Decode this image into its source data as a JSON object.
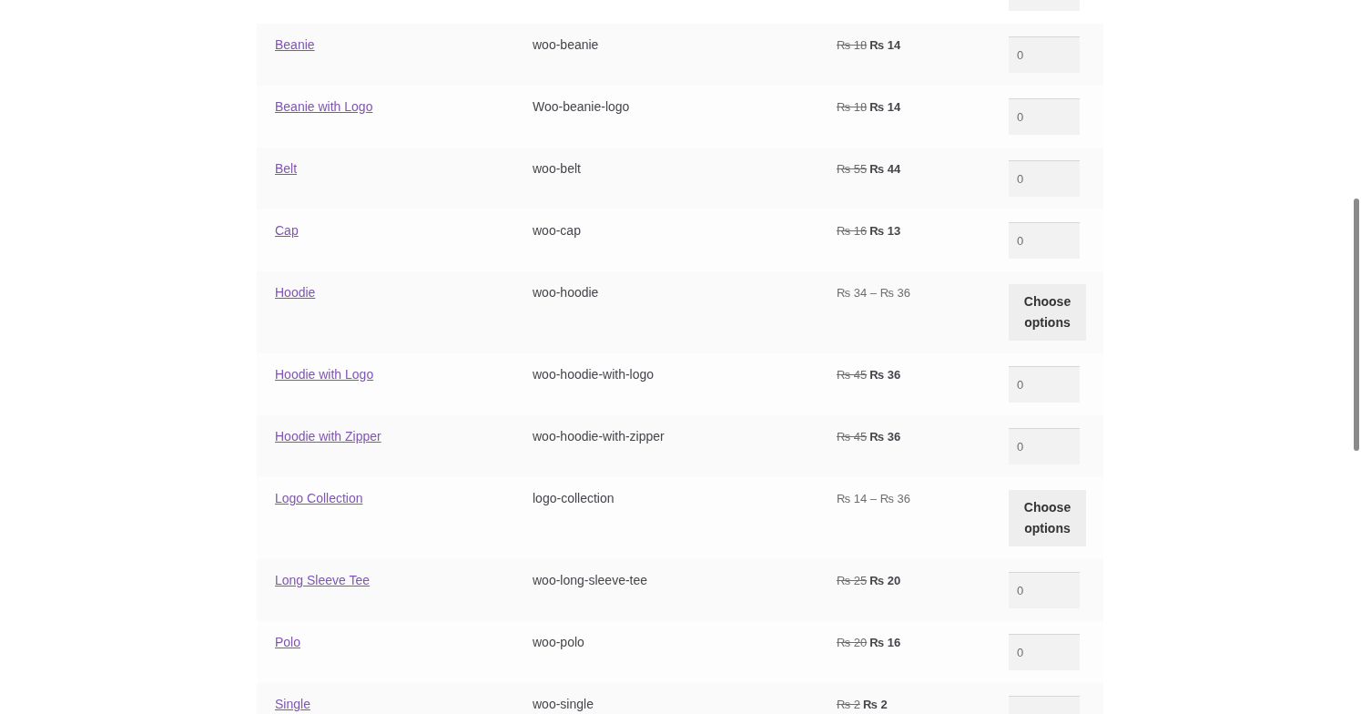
{
  "products": [
    {
      "name": "Beanie",
      "sku": "woo-beanie",
      "price": {
        "kind": "sale",
        "old": "₨ 18",
        "new": "₨ 14"
      },
      "action": {
        "kind": "quantity",
        "value": "0"
      }
    },
    {
      "name": "Beanie with Logo",
      "sku": "Woo-beanie-logo",
      "price": {
        "kind": "sale",
        "old": "₨ 18",
        "new": "₨ 14"
      },
      "action": {
        "kind": "quantity",
        "value": "0"
      }
    },
    {
      "name": "Belt",
      "sku": "woo-belt",
      "price": {
        "kind": "sale",
        "old": "₨ 55",
        "new": "₨ 44"
      },
      "action": {
        "kind": "quantity",
        "value": "0"
      }
    },
    {
      "name": "Cap",
      "sku": "woo-cap",
      "price": {
        "kind": "sale",
        "old": "₨ 16",
        "new": "₨ 13"
      },
      "action": {
        "kind": "quantity",
        "value": "0"
      }
    },
    {
      "name": "Hoodie",
      "sku": "woo-hoodie",
      "price": {
        "kind": "range",
        "text": "₨ 34 – ₨ 36"
      },
      "action": {
        "kind": "options",
        "label": "Choose options"
      }
    },
    {
      "name": "Hoodie with Logo",
      "sku": "woo-hoodie-with-logo",
      "price": {
        "kind": "sale",
        "old": "₨ 45",
        "new": "₨ 36"
      },
      "action": {
        "kind": "quantity",
        "value": "0"
      }
    },
    {
      "name": "Hoodie with Zipper",
      "sku": "woo-hoodie-with-zipper",
      "price": {
        "kind": "sale",
        "old": "₨ 45",
        "new": "₨ 36"
      },
      "action": {
        "kind": "quantity",
        "value": "0"
      }
    },
    {
      "name": "Logo Collection",
      "sku": "logo-collection",
      "price": {
        "kind": "range",
        "text": "₨ 14 – ₨ 36"
      },
      "action": {
        "kind": "options",
        "label": "Choose options"
      }
    },
    {
      "name": "Long Sleeve Tee",
      "sku": "woo-long-sleeve-tee",
      "price": {
        "kind": "sale",
        "old": "₨ 25",
        "new": "₨ 20"
      },
      "action": {
        "kind": "quantity",
        "value": "0"
      }
    },
    {
      "name": "Polo",
      "sku": "woo-polo",
      "price": {
        "kind": "sale",
        "old": "₨ 20",
        "new": "₨ 16"
      },
      "action": {
        "kind": "quantity",
        "value": "0"
      }
    },
    {
      "name": "Single",
      "sku": "woo-single",
      "price": {
        "kind": "sale",
        "old": "₨ 2",
        "new": "₨ 2"
      },
      "action": {
        "kind": "quantity"
      }
    }
  ]
}
